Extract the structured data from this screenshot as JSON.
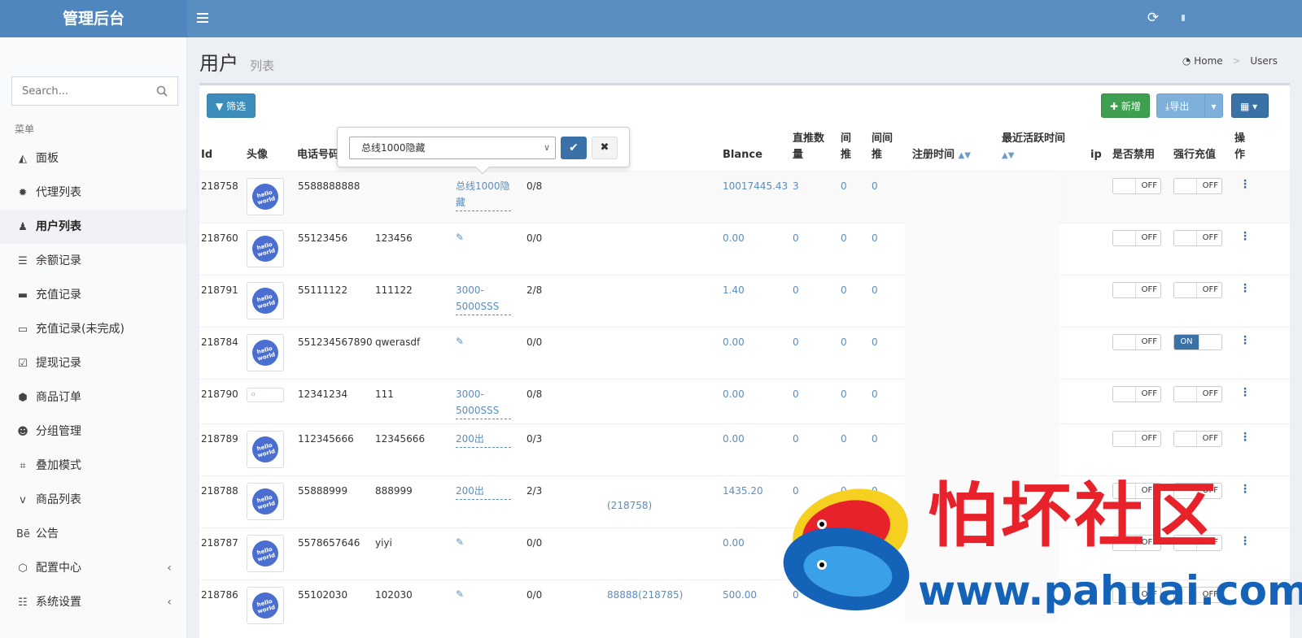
{
  "app": {
    "brand": "管理后台"
  },
  "sidebar": {
    "search_placeholder": "Search...",
    "menu_header": "菜单",
    "items": [
      {
        "label": "面板",
        "icon": "area-chart-icon"
      },
      {
        "label": "代理列表",
        "icon": "gear-icon"
      },
      {
        "label": "用户列表",
        "icon": "user-icon",
        "active": true
      },
      {
        "label": "余额记录",
        "icon": "list-icon"
      },
      {
        "label": "充值记录",
        "icon": "battery-icon"
      },
      {
        "label": "充值记录(未完成)",
        "icon": "battery-empty-icon"
      },
      {
        "label": "提现记录",
        "icon": "check-square-icon"
      },
      {
        "label": "商品订单",
        "icon": "cube-icon"
      },
      {
        "label": "分组管理",
        "icon": "users-icon"
      },
      {
        "label": "叠加模式",
        "icon": "object-group-icon"
      },
      {
        "label": "商品列表",
        "icon": "vine-icon"
      },
      {
        "label": "公告",
        "icon": "behance-icon"
      },
      {
        "label": "配置中心",
        "icon": "cubes-icon",
        "chevron": "‹"
      },
      {
        "label": "系统设置",
        "icon": "server-icon",
        "chevron": "‹"
      }
    ]
  },
  "page": {
    "title": "用户",
    "subtitle": "列表",
    "breadcrumb": {
      "home": "Home",
      "current": "Users"
    }
  },
  "toolbar": {
    "filter": "筛选",
    "add": "新增",
    "export": "导出"
  },
  "popover": {
    "selected": "总线1000隐藏"
  },
  "table": {
    "headers": {
      "id": "Id",
      "avatar": "头像",
      "phone": "电话号码",
      "blance": "Blance",
      "direct": "直推数量",
      "indirect": "间推",
      "indirect2": "间间推",
      "reg_time": "注册时间",
      "active_time": "最近活跃时间",
      "ip": "ip",
      "disabled": "是否禁用",
      "force": "强行充值",
      "ops": "操作"
    },
    "rows": [
      {
        "id": "218758",
        "phone": "5588888888",
        "pwd": "",
        "group": "总线1000隐藏",
        "ratio": "0/8",
        "parent": "",
        "blance": "10017445.43",
        "direct": "3",
        "ind": "0",
        "ind2": "0",
        "disabled": "OFF",
        "force": "OFF"
      },
      {
        "id": "218760",
        "phone": "55123456",
        "pwd": "123456",
        "group": "",
        "ratio": "0/0",
        "parent": "",
        "blance": "0.00",
        "direct": "0",
        "ind": "0",
        "ind2": "0",
        "disabled": "OFF",
        "force": "OFF"
      },
      {
        "id": "218791",
        "phone": "55111122",
        "pwd": "111122",
        "group": "3000-5000SSS",
        "ratio": "2/8",
        "parent": "",
        "blance": "1.40",
        "direct": "0",
        "ind": "0",
        "ind2": "0",
        "disabled": "OFF",
        "force": "OFF"
      },
      {
        "id": "218784",
        "phone": "551234567890",
        "pwd": "qwerasdf",
        "group": "",
        "ratio": "0/0",
        "parent": "",
        "blance": "0.00",
        "direct": "0",
        "ind": "0",
        "ind2": "0",
        "disabled": "OFF",
        "force": "ON"
      },
      {
        "id": "218790",
        "phone": "12341234",
        "pwd": "111",
        "group": "3000-5000SSS",
        "ratio": "0/8",
        "parent": "",
        "blance": "0.00",
        "direct": "0",
        "ind": "0",
        "ind2": "0",
        "disabled": "OFF",
        "force": "OFF"
      },
      {
        "id": "218789",
        "phone": "112345666",
        "pwd": "12345666",
        "group": "200出",
        "ratio": "0/3",
        "parent": "",
        "blance": "0.00",
        "direct": "0",
        "ind": "0",
        "ind2": "0",
        "disabled": "OFF",
        "force": "OFF"
      },
      {
        "id": "218788",
        "phone": "55888999",
        "pwd": "888999",
        "group": "200出",
        "ratio": "2/3",
        "parent": "(218758)",
        "blance": "1435.20",
        "direct": "0",
        "ind": "0",
        "ind2": "0",
        "disabled": "OFF",
        "force": "OFF"
      },
      {
        "id": "218787",
        "phone": "5578657646",
        "pwd": "yiyi",
        "group": "",
        "ratio": "0/0",
        "parent": "",
        "blance": "0.00",
        "direct": "0",
        "ind": "0",
        "ind2": "0",
        "disabled": "OFF",
        "force": "OFF"
      },
      {
        "id": "218786",
        "phone": "55102030",
        "pwd": "102030",
        "group": "",
        "ratio": "0/0",
        "parent": "88888(218785)",
        "blance": "500.00",
        "direct": "0",
        "ind": "0",
        "ind2": "0",
        "disabled": "OFF",
        "force": "OFF"
      }
    ],
    "avatar_text": "hello world"
  },
  "watermark": {
    "title": "怕坏社区",
    "url": "www.pahuai.com"
  },
  "colors": {
    "topbar": "#5a8dc0",
    "primary": "#3c8dbc",
    "success": "#3d9f4f",
    "link": "#5b8dbe"
  }
}
